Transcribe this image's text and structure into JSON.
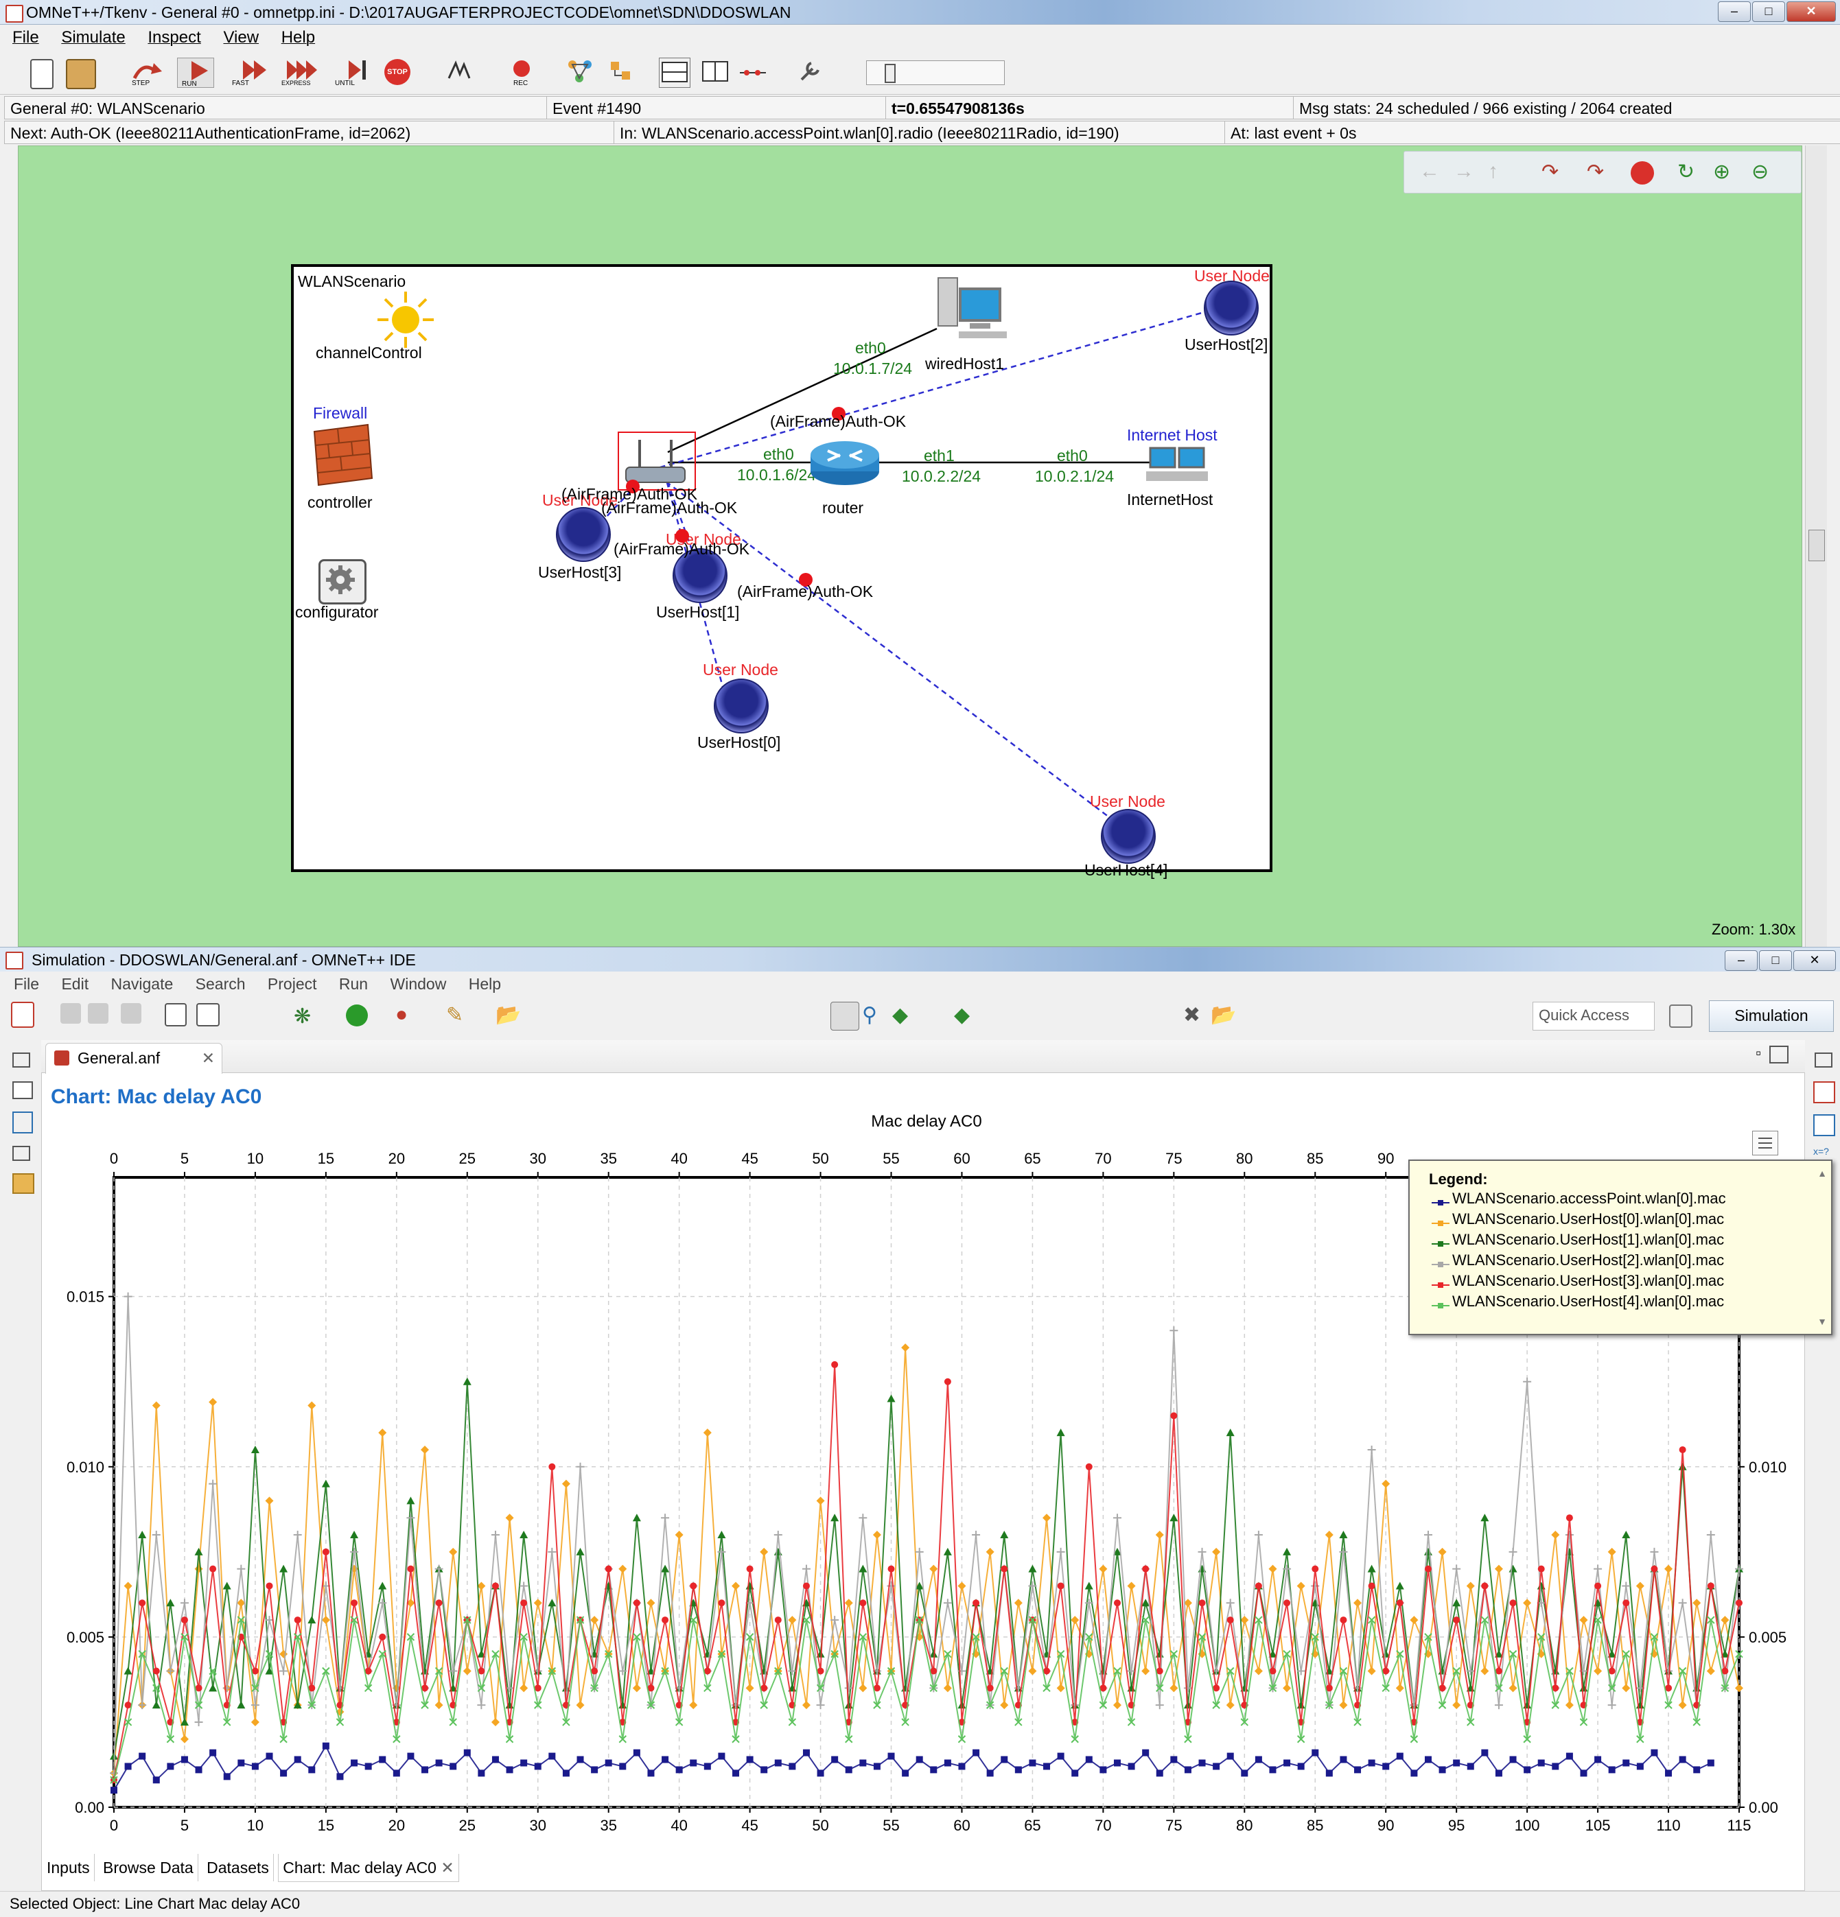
{
  "tkenv": {
    "title": "OMNeT++/Tkenv - General #0 - omnetpp.ini - D:\\2017AUGAFTERPROJECTCODE\\omnet\\SDN\\DDOSWLAN",
    "menu": [
      "File",
      "Simulate",
      "Inspect",
      "View",
      "Help"
    ],
    "toolbar": {
      "step": "STEP",
      "run": "RUN",
      "fast": "FAST",
      "express": "EXPRESS",
      "until": "UNTIL",
      "stop": "STOP",
      "rec": "REC"
    },
    "status": {
      "run": "General #0: WLANScenario",
      "event": "Event #1490",
      "time": "t=0.65547908136s",
      "msgstats": "Msg stats: 24 scheduled / 966 existing / 2064 created",
      "next": "Next: Auth-OK (Ieee80211AuthenticationFrame, id=2062)",
      "in": "In: WLANScenario.accessPoint.wlan[0].radio (Ieee80211Radio, id=190)",
      "at": "At: last event + 0s"
    },
    "zoom": "Zoom: 1.30x",
    "network": {
      "name": "WLANScenario",
      "channelControl": "channelControl",
      "firewall": "Firewall",
      "controller": "controller",
      "configurator": "configurator",
      "wiredHost": "wiredHost1",
      "router": "router",
      "internetHostTag": "Internet Host",
      "internetHost": "InternetHost",
      "userNodeTag": "User Node",
      "userHosts": [
        "UserHost[0]",
        "UserHost[1]",
        "UserHost[2]",
        "UserHost[3]",
        "UserHost[4]"
      ],
      "ap_label": "(AirFrame)Auth-OK",
      "link_labels": {
        "eth0_a": "eth0",
        "ip_a": "10.0.1.7/24",
        "eth0_b": "eth0",
        "ip_b": "10.0.1.6/24",
        "eth1": "eth1",
        "ip_c": "10.0.2.2/24",
        "eth0_c": "eth0",
        "ip_d": "10.0.2.1/24"
      },
      "frame_labels": [
        "(AirFrame)Auth-OK",
        "(AirFrame)Auth-OK",
        "(AirFrame)Auth-OK",
        "(AirFrame)Auth-OK",
        "(AirFrame)Auth-OK"
      ],
      "overlap_texts": [
        "User Node",
        "User Node",
        "accessPoint"
      ]
    }
  },
  "ide": {
    "title": "Simulation - DDOSWLAN/General.anf - OMNeT++ IDE",
    "menu": [
      "File",
      "Edit",
      "Navigate",
      "Search",
      "Project",
      "Run",
      "Window",
      "Help"
    ],
    "quick_access": "Quick Access",
    "perspective": "Simulation",
    "editor_tab": "General.anf",
    "chart_heading": "Chart: Mac delay AC0",
    "bottom_tabs": [
      "Inputs",
      "Browse Data",
      "Datasets",
      "Chart: Mac delay AC0"
    ],
    "status": "Selected Object: Line Chart Mac delay AC0"
  },
  "chart_data": {
    "type": "line",
    "title": "Mac delay AC0",
    "xlim": [
      0,
      115
    ],
    "ylim": [
      0,
      0.0185
    ],
    "xticks": [
      0,
      5,
      10,
      15,
      20,
      25,
      30,
      35,
      40,
      45,
      50,
      55,
      60,
      65,
      70,
      75,
      80,
      85,
      90,
      95,
      100,
      105,
      110,
      115
    ],
    "top_xticks": [
      0,
      5,
      10,
      15,
      20,
      25,
      30,
      35,
      40,
      45,
      50,
      55,
      60,
      65,
      70,
      75,
      80,
      85,
      90
    ],
    "yticks": [
      0,
      0.005,
      0.01,
      0.015
    ],
    "ytick_labels": [
      "0.00",
      "0.005",
      "0.010",
      "0.015"
    ],
    "right_ytick_labels": [
      "0.00",
      "0.005",
      "0.010"
    ],
    "grid": true,
    "legend_placement": "top-right",
    "legend_title": "Legend:",
    "series": [
      {
        "name": "WLANScenario.accessPoint.wlan[0].mac",
        "color": "#1a1a8c",
        "marker": "square",
        "values": [
          0.0005,
          0.0012,
          0.0015,
          0.0008,
          0.0012,
          0.0014,
          0.0011,
          0.0016,
          0.0009,
          0.0013,
          0.0012,
          0.0015,
          0.001,
          0.0014,
          0.0011,
          0.0018,
          0.0009,
          0.0013,
          0.0012,
          0.0014,
          0.001,
          0.0015,
          0.0011,
          0.0013,
          0.0012,
          0.0016,
          0.001,
          0.0014,
          0.0011,
          0.0013,
          0.0012,
          0.0015,
          0.001,
          0.0014,
          0.0011,
          0.0013,
          0.0012,
          0.0016,
          0.001,
          0.0014,
          0.0011,
          0.0013,
          0.0012,
          0.0015,
          0.001,
          0.0014,
          0.0011,
          0.0013,
          0.0012,
          0.0016,
          0.001,
          0.0014,
          0.0011,
          0.0013,
          0.0012,
          0.0015,
          0.001,
          0.0014,
          0.0011,
          0.0013,
          0.0012,
          0.0016,
          0.001,
          0.0014,
          0.0011,
          0.0013,
          0.0012,
          0.0015,
          0.001,
          0.0014,
          0.0011,
          0.0013,
          0.0012,
          0.0016,
          0.001,
          0.0014,
          0.0011,
          0.0013,
          0.0012,
          0.0015,
          0.001,
          0.0014,
          0.0011,
          0.0013,
          0.0012,
          0.0016,
          0.001,
          0.0014,
          0.0011,
          0.0013,
          0.0012,
          0.0015,
          0.001,
          0.0014,
          0.0011,
          0.0013,
          0.0012,
          0.0016,
          0.001,
          0.0014,
          0.0011,
          0.0013,
          0.0012,
          0.0015,
          0.001,
          0.0014,
          0.0011,
          0.0013,
          0.0012,
          0.0016,
          0.001,
          0.0014,
          0.0011,
          0.0013
        ]
      },
      {
        "name": "WLANScenario.UserHost[0].wlan[0].mac",
        "color": "#f5a623",
        "marker": "diamond",
        "values": [
          0.001,
          0.0065,
          0.003,
          0.0118,
          0.004,
          0.002,
          0.007,
          0.0119,
          0.0035,
          0.006,
          0.0025,
          0.009,
          0.0045,
          0.003,
          0.0118,
          0.0055,
          0.0028,
          0.007,
          0.004,
          0.011,
          0.0035,
          0.006,
          0.0105,
          0.003,
          0.0075,
          0.004,
          0.0065,
          0.0025,
          0.0085,
          0.0035,
          0.006,
          0.004,
          0.0095,
          0.003,
          0.0055,
          0.0045,
          0.007,
          0.0035,
          0.006,
          0.004,
          0.008,
          0.003,
          0.011,
          0.0045,
          0.0065,
          0.0035,
          0.0075,
          0.004,
          0.0055,
          0.003,
          0.009,
          0.0045,
          0.006,
          0.0035,
          0.008,
          0.004,
          0.0135,
          0.005,
          0.007,
          0.0035,
          0.0065,
          0.0045,
          0.0075,
          0.003,
          0.006,
          0.004,
          0.0085,
          0.0035,
          0.0055,
          0.0045,
          0.007,
          0.003,
          0.0065,
          0.004,
          0.008,
          0.0035,
          0.006,
          0.0045,
          0.0075,
          0.003,
          0.0055,
          0.004,
          0.007,
          0.0035,
          0.0065,
          0.0045,
          0.008,
          0.003,
          0.006,
          0.004,
          0.0095,
          0.0035,
          0.0055,
          0.0045,
          0.0075,
          0.003,
          0.0065,
          0.004,
          0.007,
          0.0035,
          0.006,
          0.0045,
          0.008,
          0.003,
          0.0055,
          0.004,
          0.0075,
          0.0035,
          0.0065,
          0.0045,
          0.007,
          0.003,
          0.006,
          0.004,
          0.0055,
          0.0035
        ]
      },
      {
        "name": "WLANScenario.UserHost[1].wlan[0].mac",
        "color": "#1e7a1e",
        "marker": "triangle",
        "values": [
          0.0015,
          0.004,
          0.008,
          0.003,
          0.006,
          0.0025,
          0.0075,
          0.0035,
          0.0065,
          0.003,
          0.0105,
          0.004,
          0.007,
          0.003,
          0.0055,
          0.0095,
          0.0035,
          0.008,
          0.0045,
          0.0065,
          0.003,
          0.009,
          0.004,
          0.007,
          0.0035,
          0.0125,
          0.0045,
          0.0065,
          0.003,
          0.008,
          0.004,
          0.006,
          0.0035,
          0.0075,
          0.0045,
          0.0065,
          0.003,
          0.0085,
          0.004,
          0.007,
          0.0035,
          0.006,
          0.0045,
          0.008,
          0.003,
          0.0065,
          0.004,
          0.0075,
          0.0035,
          0.006,
          0.0045,
          0.0085,
          0.003,
          0.007,
          0.004,
          0.012,
          0.0035,
          0.0065,
          0.0045,
          0.0075,
          0.003,
          0.006,
          0.004,
          0.008,
          0.0035,
          0.007,
          0.0045,
          0.011,
          0.003,
          0.0065,
          0.004,
          0.0075,
          0.0035,
          0.006,
          0.0045,
          0.0085,
          0.003,
          0.007,
          0.004,
          0.011,
          0.0035,
          0.0065,
          0.0045,
          0.0075,
          0.003,
          0.006,
          0.004,
          0.008,
          0.0035,
          0.007,
          0.0045,
          0.0065,
          0.003,
          0.0075,
          0.004,
          0.006,
          0.0035,
          0.0085,
          0.0045,
          0.007,
          0.003,
          0.0065,
          0.004,
          0.0075,
          0.0035,
          0.006,
          0.0045,
          0.008,
          0.003,
          0.007,
          0.004,
          0.01,
          0.0035,
          0.0065,
          0.0045,
          0.007
        ]
      },
      {
        "name": "WLANScenario.UserHost[2].wlan[0].mac",
        "color": "#a8a8a8",
        "marker": "plus",
        "values": [
          0.001,
          0.015,
          0.003,
          0.008,
          0.004,
          0.006,
          0.0025,
          0.0095,
          0.0035,
          0.007,
          0.003,
          0.0055,
          0.004,
          0.008,
          0.003,
          0.0065,
          0.0035,
          0.0075,
          0.004,
          0.006,
          0.003,
          0.0085,
          0.0035,
          0.007,
          0.004,
          0.0055,
          0.003,
          0.008,
          0.0035,
          0.0065,
          0.004,
          0.0075,
          0.003,
          0.01,
          0.0035,
          0.007,
          0.004,
          0.006,
          0.003,
          0.0085,
          0.0035,
          0.0065,
          0.004,
          0.0075,
          0.003,
          0.006,
          0.0035,
          0.008,
          0.004,
          0.007,
          0.003,
          0.0055,
          0.0035,
          0.0085,
          0.004,
          0.0065,
          0.003,
          0.0075,
          0.0035,
          0.006,
          0.004,
          0.008,
          0.003,
          0.007,
          0.0035,
          0.0065,
          0.004,
          0.0075,
          0.003,
          0.006,
          0.0035,
          0.0085,
          0.004,
          0.007,
          0.003,
          0.014,
          0.0035,
          0.0075,
          0.004,
          0.006,
          0.003,
          0.008,
          0.0035,
          0.007,
          0.004,
          0.0065,
          0.003,
          0.0075,
          0.0035,
          0.0105,
          0.004,
          0.006,
          0.003,
          0.008,
          0.0035,
          0.007,
          0.004,
          0.0065,
          0.003,
          0.0075,
          0.0125,
          0.006,
          0.0035,
          0.008,
          0.004,
          0.007,
          0.003,
          0.0065,
          0.0035,
          0.0075,
          0.004,
          0.006,
          0.003,
          0.008,
          0.0035,
          0.007
        ]
      },
      {
        "name": "WLANScenario.UserHost[3].wlan[0].mac",
        "color": "#e8262a",
        "marker": "circle",
        "values": [
          0.0008,
          0.003,
          0.006,
          0.004,
          0.0025,
          0.0055,
          0.0035,
          0.007,
          0.003,
          0.005,
          0.004,
          0.0065,
          0.0025,
          0.0055,
          0.0035,
          0.0075,
          0.003,
          0.006,
          0.004,
          0.005,
          0.0025,
          0.007,
          0.0035,
          0.006,
          0.003,
          0.0055,
          0.004,
          0.0065,
          0.0025,
          0.006,
          0.0035,
          0.01,
          0.003,
          0.0055,
          0.004,
          0.007,
          0.0025,
          0.006,
          0.0035,
          0.0055,
          0.003,
          0.0065,
          0.004,
          0.006,
          0.0025,
          0.007,
          0.0035,
          0.0055,
          0.003,
          0.0065,
          0.004,
          0.013,
          0.0025,
          0.006,
          0.0035,
          0.007,
          0.003,
          0.0055,
          0.004,
          0.0125,
          0.0025,
          0.006,
          0.0035,
          0.007,
          0.003,
          0.0055,
          0.004,
          0.0065,
          0.0025,
          0.01,
          0.0035,
          0.006,
          0.003,
          0.007,
          0.004,
          0.0115,
          0.0025,
          0.006,
          0.0035,
          0.0055,
          0.003,
          0.0065,
          0.004,
          0.006,
          0.0025,
          0.007,
          0.0035,
          0.0055,
          0.003,
          0.0065,
          0.004,
          0.006,
          0.0025,
          0.007,
          0.0035,
          0.0055,
          0.003,
          0.0065,
          0.004,
          0.006,
          0.0025,
          0.007,
          0.0035,
          0.0085,
          0.003,
          0.0065,
          0.004,
          0.006,
          0.0025,
          0.007,
          0.0035,
          0.0105,
          0.003,
          0.0065,
          0.004,
          0.006
        ]
      },
      {
        "name": "WLANScenario.UserHost[4].wlan[0].mac",
        "color": "#5cc25c",
        "marker": "x",
        "values": [
          0.0008,
          0.0025,
          0.0045,
          0.0035,
          0.002,
          0.005,
          0.003,
          0.004,
          0.0025,
          0.0055,
          0.0035,
          0.0045,
          0.002,
          0.005,
          0.003,
          0.004,
          0.0025,
          0.0055,
          0.0035,
          0.0045,
          0.002,
          0.005,
          0.003,
          0.004,
          0.0025,
          0.0055,
          0.0035,
          0.0045,
          0.002,
          0.005,
          0.003,
          0.004,
          0.0025,
          0.0055,
          0.0035,
          0.0045,
          0.002,
          0.005,
          0.003,
          0.004,
          0.0025,
          0.0055,
          0.0035,
          0.0045,
          0.002,
          0.005,
          0.003,
          0.004,
          0.0025,
          0.0055,
          0.0035,
          0.0045,
          0.002,
          0.005,
          0.003,
          0.004,
          0.0025,
          0.0055,
          0.0035,
          0.0045,
          0.002,
          0.005,
          0.003,
          0.004,
          0.0025,
          0.0055,
          0.0035,
          0.0045,
          0.002,
          0.005,
          0.003,
          0.004,
          0.0025,
          0.0055,
          0.0035,
          0.0045,
          0.002,
          0.005,
          0.003,
          0.004,
          0.0025,
          0.0055,
          0.0035,
          0.0045,
          0.002,
          0.005,
          0.003,
          0.004,
          0.0025,
          0.0055,
          0.0035,
          0.0045,
          0.002,
          0.005,
          0.003,
          0.004,
          0.0025,
          0.0055,
          0.0035,
          0.0045,
          0.002,
          0.005,
          0.003,
          0.004,
          0.0025,
          0.0055,
          0.0035,
          0.0045,
          0.002,
          0.005,
          0.003,
          0.004,
          0.0025,
          0.0055,
          0.0035,
          0.0045
        ]
      }
    ]
  }
}
